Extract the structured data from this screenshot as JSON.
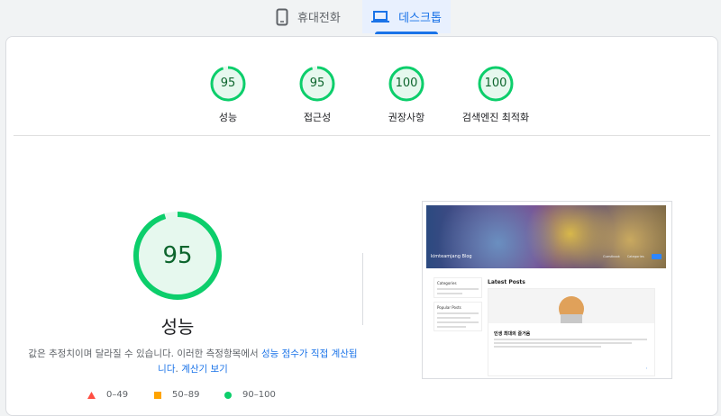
{
  "device_tabs": {
    "mobile_label": "휴대전화",
    "desktop_label": "데스크톱",
    "active": "desktop"
  },
  "summary_scores": [
    {
      "label": "성능",
      "score": "95"
    },
    {
      "label": "접근성",
      "score": "95"
    },
    {
      "label": "권장사항",
      "score": "100"
    },
    {
      "label": "검색엔진 최적화",
      "score": "100"
    }
  ],
  "performance": {
    "score": "95",
    "title": "성능",
    "desc_prefix": "값은 추정치이며 달라질 수 있습니다. 이러한 측정항목에서 ",
    "desc_link1": "성능 점수가 직접 계산됩니다",
    "desc_sep": ". ",
    "desc_link2": "계산기 보기"
  },
  "legend": [
    {
      "range": "0–49",
      "color": "#ff4e42",
      "icon": "triangle-icon"
    },
    {
      "range": "50–89",
      "color": "#ffa400",
      "icon": "square-icon"
    },
    {
      "range": "90–100",
      "color": "#0cce6b",
      "icon": "circle-icon"
    }
  ],
  "colors": {
    "pass": "#0cce6b",
    "pass_text": "#0d652d",
    "accent": "#1a73e8"
  },
  "thumbnail": {
    "site_title": "kimteamjang Blog",
    "nav": [
      "Guestbook",
      "Categories"
    ],
    "categories_title": "Categories",
    "popular_title": "Popular Posts",
    "latest_title": "Latest Posts",
    "post_title": "인생 최대의 즐거움"
  }
}
